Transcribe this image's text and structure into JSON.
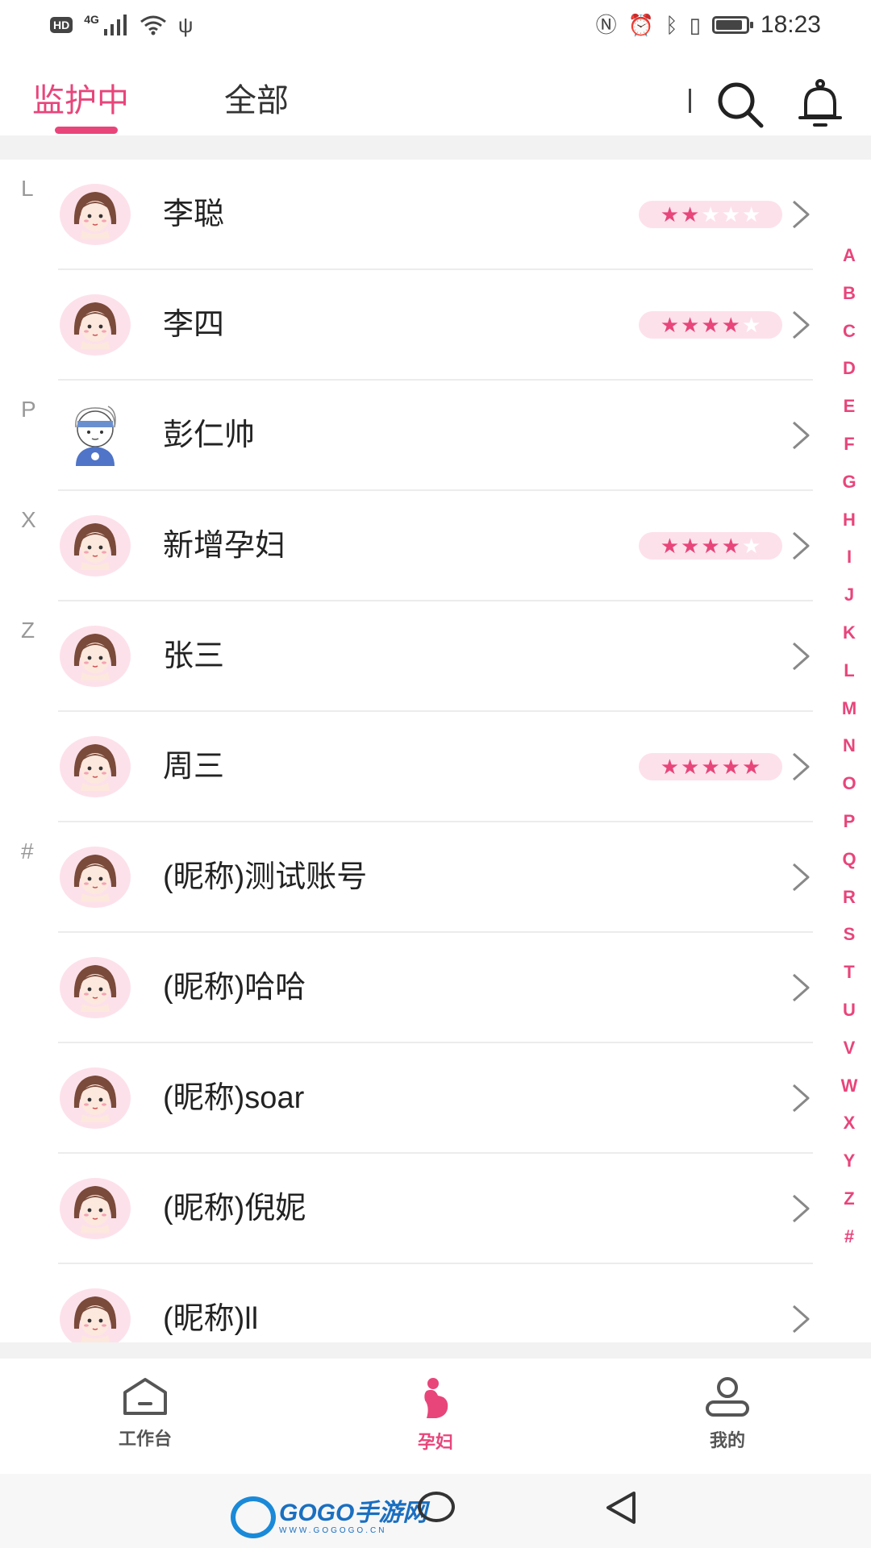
{
  "status_bar": {
    "hd": "HD",
    "network": "4G",
    "time": "18:23",
    "battery_level": 0.9
  },
  "header": {
    "tabs": [
      {
        "label": "监护中",
        "active": true
      },
      {
        "label": "全部",
        "active": false
      }
    ],
    "icons": [
      "search-icon",
      "bell-icon"
    ]
  },
  "contacts": [
    {
      "section": "L",
      "name": "李聪",
      "stars": 2,
      "avatar": "girl-avatar"
    },
    {
      "section": "",
      "name": "李四",
      "stars": 4,
      "avatar": "girl-avatar"
    },
    {
      "section": "P",
      "name": "彭仁帅",
      "stars": null,
      "avatar": "boy-avatar"
    },
    {
      "section": "X",
      "name": "新增孕妇",
      "stars": 4,
      "avatar": "girl-avatar"
    },
    {
      "section": "Z",
      "name": "张三",
      "stars": null,
      "avatar": "girl-avatar"
    },
    {
      "section": "",
      "name": "周三",
      "stars": 5,
      "avatar": "girl-avatar"
    },
    {
      "section": "#",
      "name": "(昵称)测试账号",
      "stars": null,
      "avatar": "girl-avatar"
    },
    {
      "section": "",
      "name": "(昵称)哈哈",
      "stars": null,
      "avatar": "girl-avatar"
    },
    {
      "section": "",
      "name": "(昵称)soar",
      "stars": null,
      "avatar": "girl-avatar"
    },
    {
      "section": "",
      "name": "(昵称)倪妮",
      "stars": null,
      "avatar": "girl-avatar"
    },
    {
      "section": "",
      "name": "(昵称)ll",
      "stars": null,
      "avatar": "girl-avatar"
    }
  ],
  "alpha_index": [
    "A",
    "B",
    "C",
    "D",
    "E",
    "F",
    "G",
    "H",
    "I",
    "J",
    "K",
    "L",
    "M",
    "N",
    "O",
    "P",
    "Q",
    "R",
    "S",
    "T",
    "U",
    "V",
    "W",
    "X",
    "Y",
    "Z",
    "#"
  ],
  "bottom_nav": [
    {
      "label": "工作台",
      "icon": "home-icon",
      "active": false
    },
    {
      "label": "孕妇",
      "icon": "pregnant-icon",
      "active": true
    },
    {
      "label": "我的",
      "icon": "user-icon",
      "active": false
    }
  ],
  "watermark": {
    "main": "GOGO手游网",
    "sub": "WWW.GOGOGO.CN"
  },
  "colors": {
    "accent": "#e8457b",
    "rating_bg": "#fde1ea",
    "divider": "#ececec"
  }
}
